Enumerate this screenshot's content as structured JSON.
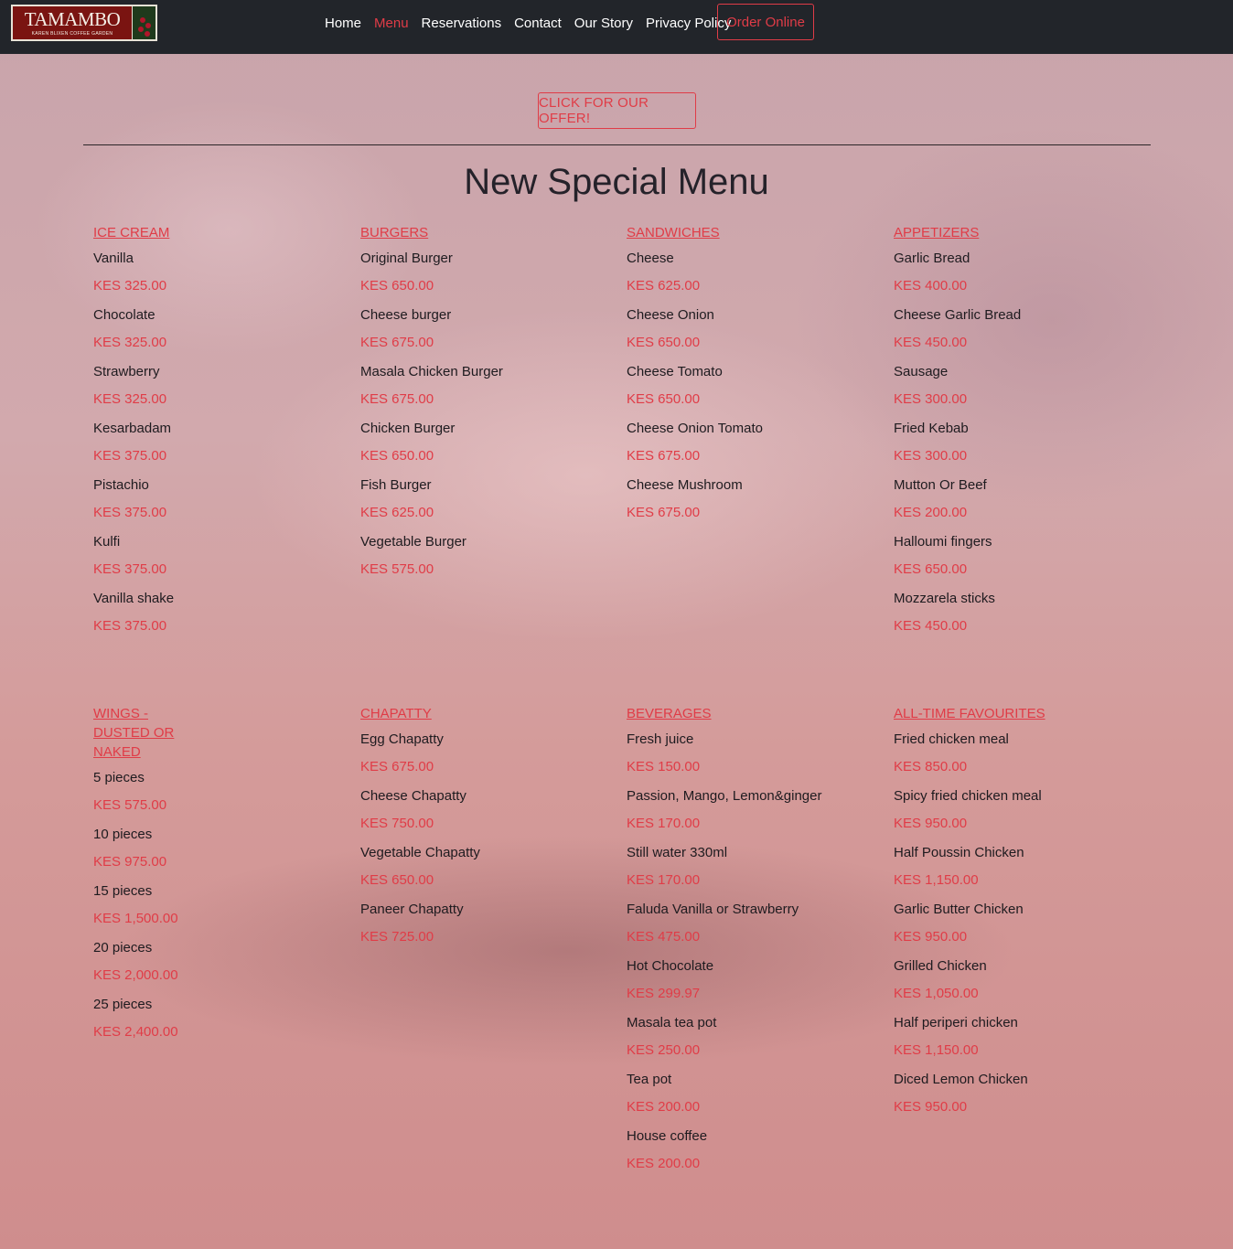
{
  "brand": {
    "name": "TAMAMBO",
    "tagline": "KAREN BLIXEN COFFEE GARDEN"
  },
  "nav": {
    "links": [
      "Home",
      "Menu",
      "Reservations",
      "Contact",
      "Our Story",
      "Privacy Policy"
    ],
    "active": "Menu",
    "order_label": "Order Online"
  },
  "offer_label": "CLICK FOR OUR OFFER!",
  "title": "New Special Menu",
  "colors": {
    "accent": "#e03c47",
    "navbar": "#22252a",
    "text": "#1e1b1f"
  },
  "sections": [
    {
      "name": "ICE CREAM",
      "items": [
        {
          "name": "Vanilla",
          "price": "KES 325.00"
        },
        {
          "name": "Chocolate",
          "price": "KES 325.00"
        },
        {
          "name": "Strawberry",
          "price": "KES 325.00"
        },
        {
          "name": "Kesarbadam",
          "price": "KES 375.00"
        },
        {
          "name": "Pistachio",
          "price": "KES 375.00"
        },
        {
          "name": "Kulfi",
          "price": "KES 375.00"
        },
        {
          "name": "Vanilla shake",
          "price": "KES 375.00"
        }
      ]
    },
    {
      "name": "BURGERS",
      "items": [
        {
          "name": "Original Burger",
          "price": "KES 650.00"
        },
        {
          "name": "Cheese burger",
          "price": "KES 675.00"
        },
        {
          "name": "Masala Chicken Burger",
          "price": "KES 675.00"
        },
        {
          "name": "Chicken Burger",
          "price": "KES 650.00"
        },
        {
          "name": "Fish Burger",
          "price": "KES 625.00"
        },
        {
          "name": "Vegetable Burger",
          "price": "KES 575.00"
        }
      ]
    },
    {
      "name": "SANDWICHES",
      "items": [
        {
          "name": "Cheese",
          "price": "KES 625.00"
        },
        {
          "name": "Cheese Onion",
          "price": "KES 650.00"
        },
        {
          "name": "Cheese Tomato",
          "price": "KES 650.00"
        },
        {
          "name": "Cheese Onion Tomato",
          "price": "KES 675.00"
        },
        {
          "name": "Cheese Mushroom",
          "price": "KES 675.00"
        }
      ]
    },
    {
      "name": "APPETIZERS",
      "items": [
        {
          "name": "Garlic Bread",
          "price": "KES 400.00"
        },
        {
          "name": "Cheese Garlic Bread",
          "price": "KES 450.00"
        },
        {
          "name": "Sausage",
          "price": "KES 300.00"
        },
        {
          "name": "Fried Kebab",
          "price": "KES 300.00"
        },
        {
          "name": "Mutton Or Beef",
          "price": "KES 200.00"
        },
        {
          "name": "Halloumi fingers",
          "price": "KES 650.00"
        },
        {
          "name": "Mozzarela sticks",
          "price": "KES 450.00"
        }
      ]
    },
    {
      "name": "WINGS - DUSTED OR NAKED",
      "items": [
        {
          "name": "5 pieces",
          "price": "KES 575.00"
        },
        {
          "name": "10 pieces",
          "price": "KES 975.00"
        },
        {
          "name": "15 pieces",
          "price": "KES 1,500.00"
        },
        {
          "name": "20 pieces",
          "price": "KES 2,000.00"
        },
        {
          "name": "25 pieces",
          "price": "KES 2,400.00"
        }
      ]
    },
    {
      "name": "CHAPATTY",
      "items": [
        {
          "name": "Egg Chapatty",
          "price": "KES 675.00"
        },
        {
          "name": "Cheese Chapatty",
          "price": "KES 750.00"
        },
        {
          "name": "Vegetable Chapatty",
          "price": "KES 650.00"
        },
        {
          "name": "Paneer Chapatty",
          "price": "KES 725.00"
        }
      ]
    },
    {
      "name": "BEVERAGES",
      "items": [
        {
          "name": "Fresh juice",
          "price": "KES 150.00"
        },
        {
          "name": "Passion, Mango, Lemon&ginger",
          "price": "KES 170.00"
        },
        {
          "name": "Still water 330ml",
          "price": "KES 170.00"
        },
        {
          "name": "Faluda Vanilla or Strawberry",
          "price": "KES 475.00"
        },
        {
          "name": "Hot Chocolate",
          "price": "KES 299.97"
        },
        {
          "name": "Masala tea pot",
          "price": "KES 250.00"
        },
        {
          "name": "Tea pot",
          "price": "KES 200.00"
        },
        {
          "name": "House coffee",
          "price": "KES 200.00"
        }
      ]
    },
    {
      "name": "ALL-TIME FAVOURITES",
      "items": [
        {
          "name": "Fried chicken meal",
          "price": "KES 850.00"
        },
        {
          "name": "Spicy fried chicken meal",
          "price": "KES 950.00"
        },
        {
          "name": "Half Poussin Chicken",
          "price": "KES 1,150.00"
        },
        {
          "name": "Garlic Butter Chicken",
          "price": "KES 950.00"
        },
        {
          "name": "Grilled Chicken",
          "price": "KES 1,050.00"
        },
        {
          "name": "Half periperi chicken",
          "price": "KES 1,150.00"
        },
        {
          "name": "Diced Lemon Chicken",
          "price": "KES 950.00"
        }
      ]
    }
  ]
}
